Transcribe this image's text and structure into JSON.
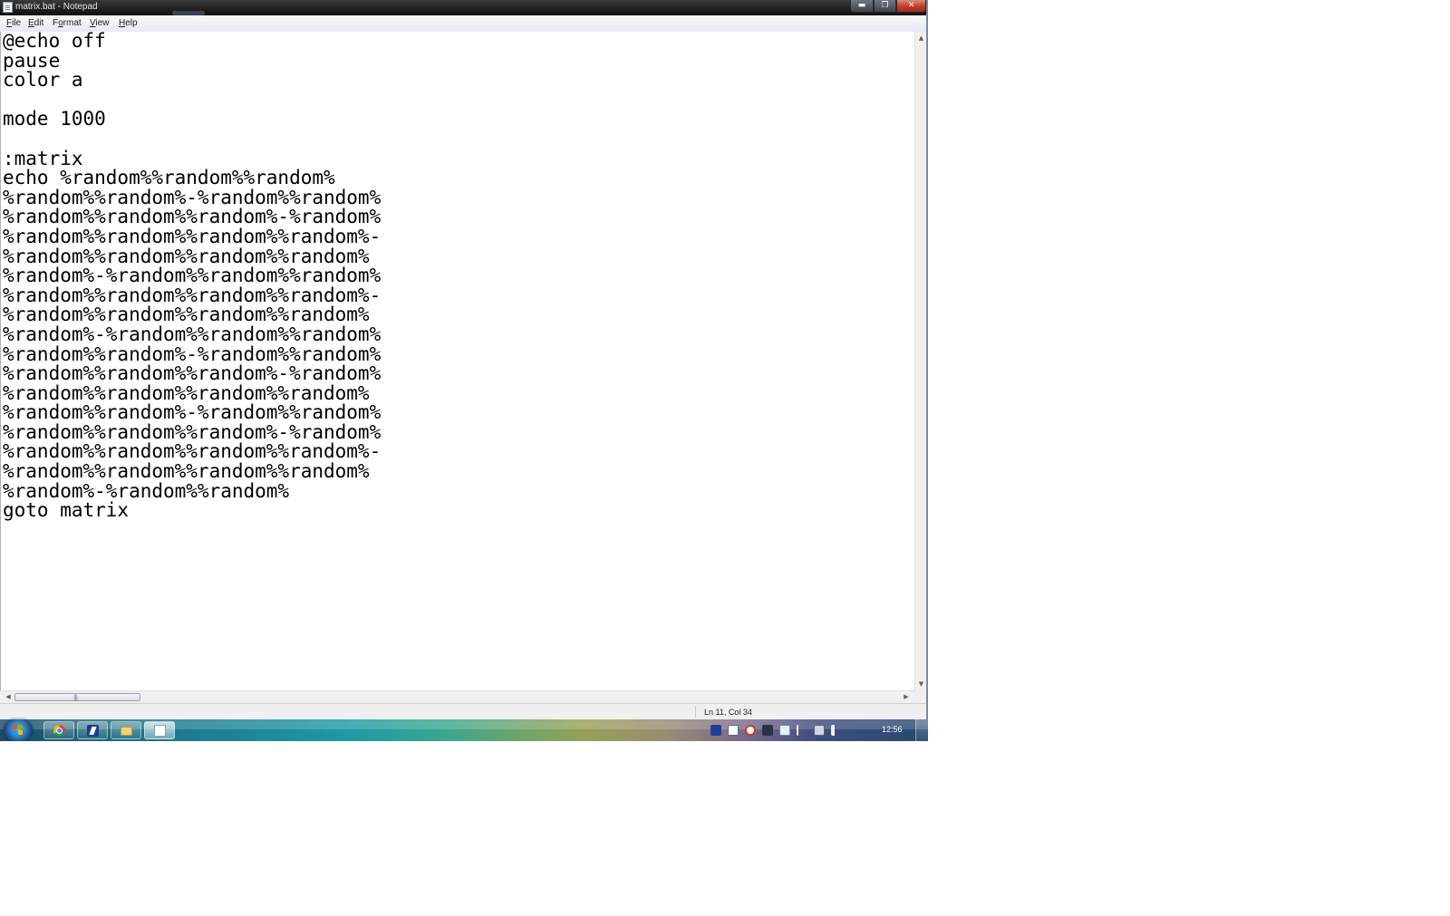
{
  "window": {
    "title": "matrix.bat - Notepad",
    "min_glyph": "▬",
    "max_glyph": "❐",
    "close_glyph": "✕"
  },
  "menu": {
    "file": {
      "first": "F",
      "rest": "ile"
    },
    "edit": {
      "first": "E",
      "rest": "dit"
    },
    "format": {
      "pre": "F",
      "mid": "o",
      "post": "rmat"
    },
    "view": {
      "first": "V",
      "rest": "iew"
    },
    "help": {
      "first": "H",
      "rest": "elp"
    }
  },
  "editor": {
    "text": "@echo off\npause\ncolor a\n\nmode 1000\n\n:matrix\necho %random%%random%%random%\n%random%%random%-%random%%random%\n%random%%random%%random%-%random%\n%random%%random%%random%%random%-\n%random%%random%%random%%random%\n%random%-%random%%random%%random%\n%random%%random%%random%%random%-\n%random%%random%%random%%random%\n%random%-%random%%random%%random%\n%random%%random%-%random%%random%\n%random%%random%%random%-%random%\n%random%%random%%random%%random%\n%random%%random%-%random%%random%\n%random%%random%%random%-%random%\n%random%%random%%random%%random%-\n%random%%random%%random%%random%\n%random%-%random%%random%\ngoto matrix"
  },
  "scrollbars": {
    "up": "▲",
    "down": "▼",
    "left": "◀",
    "right": "▶",
    "grip": "|||"
  },
  "statusbar": {
    "position": "Ln 11, Col 34"
  },
  "taskbar": {
    "pinned": [
      "chrome-icon",
      "app-icon",
      "explorer-folder-icon",
      "notepad-icon"
    ],
    "active": "notepad-icon",
    "tray_icons": [
      "blue-app-icon",
      "grid-app-icon",
      "record-icon",
      "network-tool-icon",
      "document-icon",
      "action-center-flag-icon",
      "network-icon",
      "volume-icon"
    ],
    "clock": "12:56"
  },
  "colors": {
    "titlebar": "#1a1a1a",
    "close_button": "#c0392b",
    "editor_background": "#ffffff",
    "editor_text": "#000000"
  }
}
